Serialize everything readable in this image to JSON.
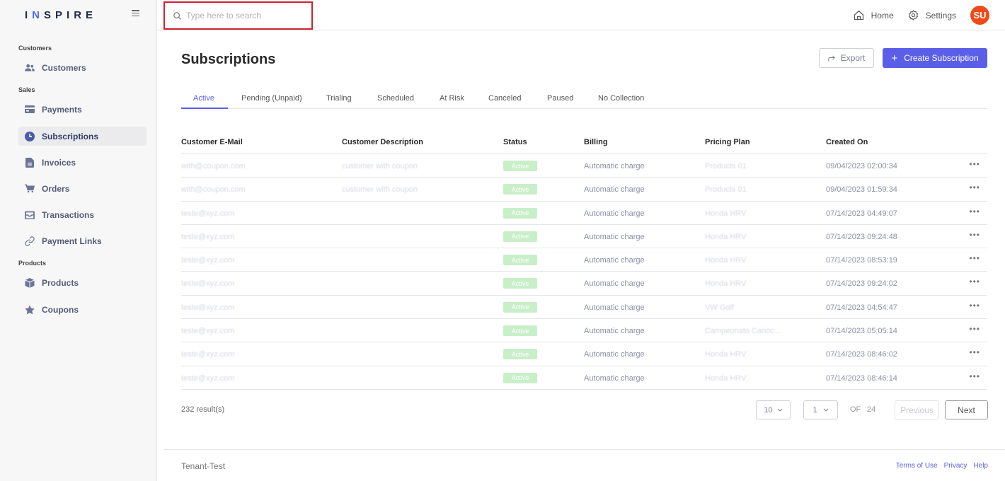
{
  "brand": {
    "logo_prefix": "I",
    "logo_n": "N",
    "logo_suffix": "SPIRE"
  },
  "sidebar": {
    "sections": [
      "Customers",
      "Sales",
      "Products"
    ],
    "items": [
      {
        "label": "Customers",
        "icon": "users-icon"
      },
      {
        "label": "Payments",
        "icon": "credit-card-icon"
      },
      {
        "label": "Subscriptions",
        "icon": "clock-icon",
        "active": true
      },
      {
        "label": "Invoices",
        "icon": "document-icon"
      },
      {
        "label": "Orders",
        "icon": "cart-icon"
      },
      {
        "label": "Transactions",
        "icon": "inbox-icon"
      },
      {
        "label": "Payment Links",
        "icon": "link-icon"
      },
      {
        "label": "Products",
        "icon": "box-icon"
      },
      {
        "label": "Coupons",
        "icon": "star-icon"
      }
    ]
  },
  "topbar": {
    "search_placeholder": "Type here to search",
    "home_label": "Home",
    "settings_label": "Settings",
    "avatar_initials": "SU"
  },
  "page": {
    "title": "Subscriptions",
    "export_label": "Export",
    "create_label": "Create Subscription"
  },
  "tabs": [
    "Active",
    "Pending (Unpaid)",
    "Trialing",
    "Scheduled",
    "At Risk",
    "Canceled",
    "Paused",
    "No Collection"
  ],
  "table": {
    "headers": [
      "Customer E-Mail",
      "Customer Description",
      "Status",
      "Billing",
      "Pricing Plan",
      "Created On"
    ],
    "rows": [
      {
        "email": "with@coupon.com",
        "description": "customer with coupon",
        "status": "Active",
        "billing": "Automatic charge",
        "plan": "Products 01",
        "created": "09/04/2023 02:00:34"
      },
      {
        "email": "with@coupon.com",
        "description": "customer with coupon",
        "status": "Active",
        "billing": "Automatic charge",
        "plan": "Products 01",
        "created": "09/04/2023 01:59:34"
      },
      {
        "email": "teste@xyz.com",
        "description": "",
        "status": "Active",
        "billing": "Automatic charge",
        "plan": "Honda HRV",
        "created": "07/14/2023 04:49:07"
      },
      {
        "email": "teste@xyz.com",
        "description": "",
        "status": "Active",
        "billing": "Automatic charge",
        "plan": "Honda HRV",
        "created": "07/14/2023 09:24:48"
      },
      {
        "email": "teste@xyz.com",
        "description": "",
        "status": "Active",
        "billing": "Automatic charge",
        "plan": "Honda HRV",
        "created": "07/14/2023 08:53:19"
      },
      {
        "email": "teste@xyz.com",
        "description": "",
        "status": "Active",
        "billing": "Automatic charge",
        "plan": "Honda HRV",
        "created": "07/14/2023 09:24:02"
      },
      {
        "email": "teste@xyz.com",
        "description": "",
        "status": "Active",
        "billing": "Automatic charge",
        "plan": "VW Golf",
        "created": "07/14/2023 04:54:47"
      },
      {
        "email": "teste@xyz.com",
        "description": "",
        "status": "Active",
        "billing": "Automatic charge",
        "plan": "Campeonato Carioc...",
        "created": "07/14/2023 05:05:14"
      },
      {
        "email": "teste@xyz.com",
        "description": "",
        "status": "Active",
        "billing": "Automatic charge",
        "plan": "Honda HRV",
        "created": "07/14/2023 08:46:02"
      },
      {
        "email": "teste@xyz.com",
        "description": "",
        "status": "Active",
        "billing": "Automatic charge",
        "plan": "Honda HRV",
        "created": "07/14/2023 08:46:14"
      }
    ],
    "row_menu": "•••"
  },
  "pagination": {
    "results": "232 result(s)",
    "page_size": "10",
    "current_page": "1",
    "of_label": "OF",
    "total_pages": "24",
    "previous_label": "Previous",
    "next_label": "Next"
  },
  "footer": {
    "tenant": "Tenant-Test",
    "links": [
      "Terms of Use",
      "Privacy",
      "Help"
    ]
  },
  "colors": {
    "accent": "#5b5fe8",
    "avatar": "#ef4a18",
    "active_badge": "#c9efc9",
    "search_highlight": "#d2202f"
  }
}
